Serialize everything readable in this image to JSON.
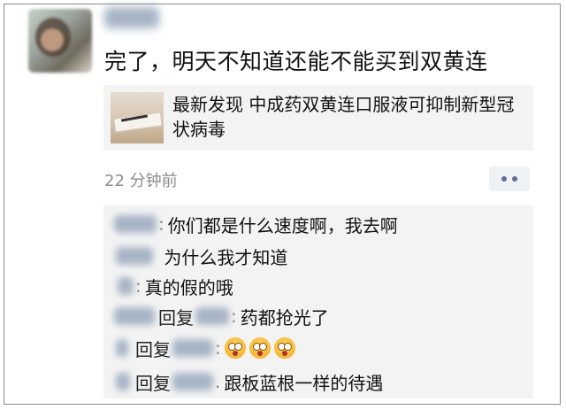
{
  "post": {
    "text": "完了，明天不知道还能不能买到双黄连",
    "link_title": "最新发现 中成药双黄连口服液可抑制新型冠状病毒",
    "time": "22 分钟前"
  },
  "comments": [
    {
      "type": "comment",
      "text": "你们都是什么速度啊，我去啊"
    },
    {
      "type": "comment",
      "text": "为什么我才知道"
    },
    {
      "type": "comment",
      "text": "真的假的哦"
    },
    {
      "type": "reply",
      "reply_label": "回复",
      "text": "药都抢光了"
    },
    {
      "type": "reply",
      "reply_label": "回复",
      "emoji": [
        "flushed-face-icon",
        "flushed-face-icon",
        "flushed-face-icon"
      ]
    },
    {
      "type": "reply",
      "reply_label": "回复",
      "text": "跟板蓝根一样的待遇"
    }
  ],
  "colors": {
    "accent_dots": "#5d6f92",
    "card_bg": "#f3f3f3",
    "time_gray": "#8c8c8c"
  }
}
